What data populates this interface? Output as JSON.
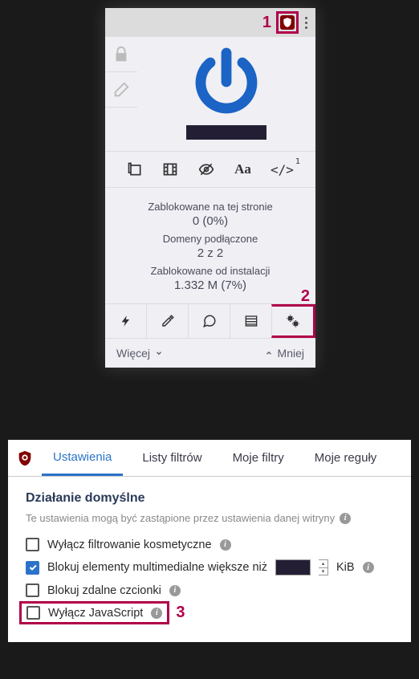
{
  "annotations": {
    "one": "1",
    "two": "2",
    "three": "3"
  },
  "popup": {
    "sidebar": {
      "lock": "lock-icon",
      "erase": "eraser-icon"
    },
    "tools": [
      "popup-icon",
      "film-icon",
      "eye-slash-icon",
      "font-icon",
      "code-icon"
    ],
    "code_sup": "1",
    "stats": {
      "blocked_page_label": "Zablokowane na tej stronie",
      "blocked_page_value": "0 (0%)",
      "domains_label": "Domeny podłączone",
      "domains_value": "2 z 2",
      "blocked_install_label": "Zablokowane od instalacji",
      "blocked_install_value": "1.332 M (7%)"
    },
    "bottom": [
      "bolt-icon",
      "dropper-icon",
      "chat-icon",
      "list-icon",
      "gear-icon"
    ],
    "expand": {
      "more": "Więcej",
      "less": "Mniej"
    }
  },
  "settings": {
    "tabs": {
      "settings": "Ustawienia",
      "filter_lists": "Listy filtrów",
      "my_filters": "Moje filtry",
      "my_rules": "Moje reguły"
    },
    "section_title": "Działanie domyślne",
    "section_sub": "Te ustawienia mogą być zastąpione przez ustawienia danej witryny",
    "opts": {
      "cosmetic": "Wyłącz filtrowanie kosmetyczne",
      "media": "Blokuj elementy multimedialne większe niż",
      "kib": "KiB",
      "fonts": "Blokuj zdalne czcionki",
      "js": "Wyłącz JavaScript"
    }
  }
}
